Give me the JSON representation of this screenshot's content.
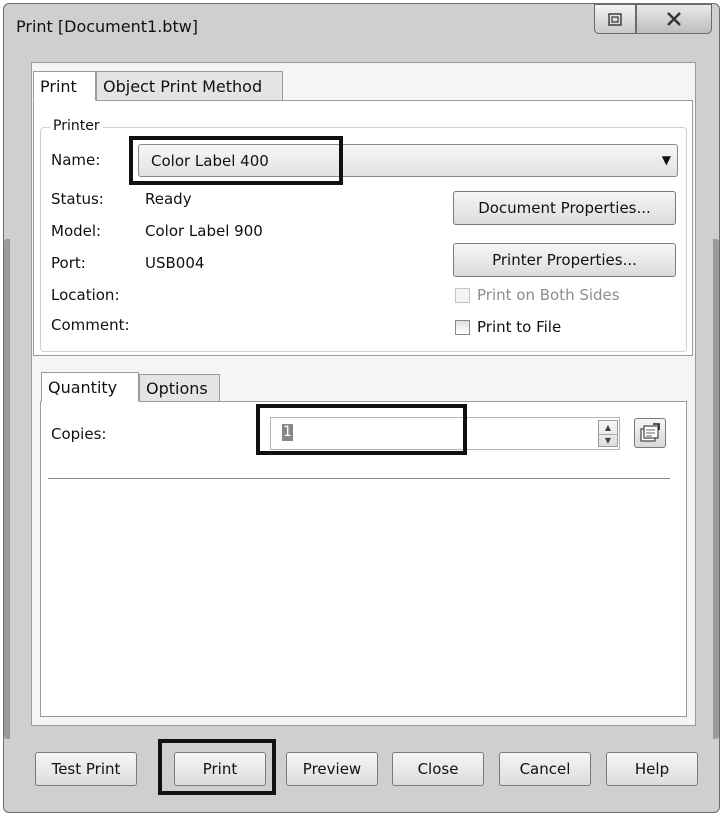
{
  "window": {
    "title": "Print [Document1.btw]"
  },
  "tabs": [
    {
      "label": "Print"
    },
    {
      "label": "Object Print Method"
    }
  ],
  "printer": {
    "group_label": "Printer",
    "name_label": "Name:",
    "name_value": "Color Label 400",
    "status_label": "Status:",
    "status_value": "Ready",
    "model_label": "Model:",
    "model_value": "Color Label 900",
    "port_label": "Port:",
    "port_value": "USB004",
    "location_label": "Location:",
    "comment_label": "Comment:",
    "document_properties": "Document Properties...",
    "printer_properties": "Printer Properties...",
    "print_both_sides": "Print on Both Sides",
    "print_to_file": "Print to File"
  },
  "subtabs": [
    {
      "label": "Quantity"
    },
    {
      "label": "Options"
    }
  ],
  "quantity": {
    "copies_label": "Copies:",
    "copies_value": "1"
  },
  "buttons": {
    "test_print": "Test Print",
    "print": "Print",
    "preview": "Preview",
    "close": "Close",
    "cancel": "Cancel",
    "help": "Help"
  },
  "icons": {
    "restore": "restore-icon",
    "close": "close-icon",
    "dropdown": "chevron-down-icon",
    "copies_settings": "copies-settings-icon"
  },
  "colors": {
    "highlight_box": "#111111",
    "dialog_background": "#f5f5f5"
  }
}
